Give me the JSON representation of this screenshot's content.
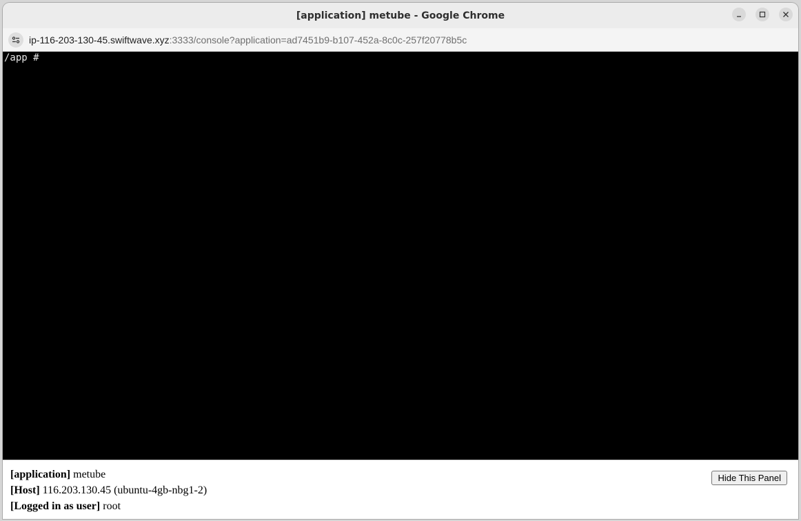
{
  "window": {
    "title": "[application] metube - Google Chrome"
  },
  "addressbar": {
    "host": "ip-116-203-130-45.swiftwave.xyz",
    "rest": ":3333/console?application=ad7451b9-b107-452a-8c0c-257f20778b5c",
    "site_info_icon": "tune-icon"
  },
  "terminal": {
    "prompt": "/app # "
  },
  "panel": {
    "application_label": "[application]",
    "application_value": " metube",
    "host_label": "[Host]",
    "host_value": " 116.203.130.45 (ubuntu-4gb-nbg1-2)",
    "user_label": "[Logged in as user]",
    "user_value": " root",
    "hide_button": "Hide This Panel"
  }
}
